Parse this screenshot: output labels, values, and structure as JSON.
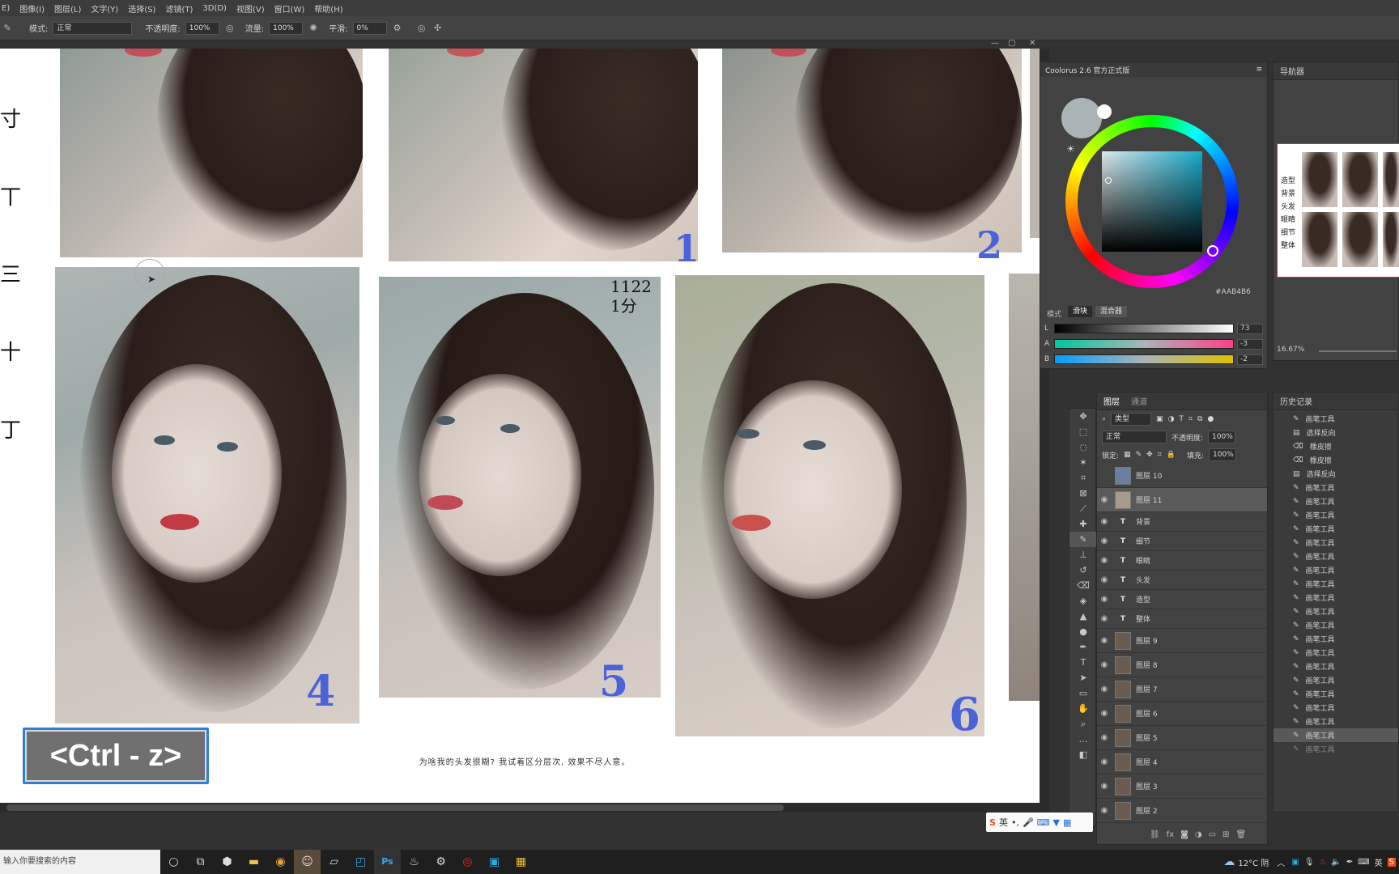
{
  "menubar": {
    "items": [
      "E)",
      "图像(I)",
      "图层(L)",
      "文字(Y)",
      "选择(S)",
      "滤镜(T)",
      "3D(D)",
      "视图(V)",
      "窗口(W)",
      "帮助(H)"
    ]
  },
  "options": {
    "mode_label": "模式:",
    "mode_value": "正常",
    "opacity_label": "不透明度:",
    "opacity_value": "100%",
    "flow_label": "流量:",
    "flow_value": "100%",
    "smooth_label": "平滑:",
    "smooth_value": "0%"
  },
  "canvas": {
    "numbers": [
      "1",
      "2",
      "4",
      "5",
      "6"
    ],
    "signature": "1122 1分",
    "caption": "为啥我的头发很糊? 我试着区分层次, 效果不尽人意。",
    "shortcut_label": "<Ctrl - z>",
    "left_strokes": [
      "寸",
      "丅",
      "三",
      "十",
      "丁"
    ]
  },
  "coolorus": {
    "title": "Coolorus 2.6 官方正式版",
    "hex": "#AAB4B6",
    "mode_label": "模式",
    "tab_slider": "滑块",
    "tab_mixer": "混合器",
    "sliders": [
      {
        "label": "L",
        "value": "73"
      },
      {
        "label": "A",
        "value": "-3"
      },
      {
        "label": "B",
        "value": "-2"
      }
    ]
  },
  "navigator": {
    "title": "导航器",
    "zoom": "16.67%",
    "thumb_labels": [
      "造型",
      "背景",
      "头发",
      "眼睛",
      "细节",
      "整体"
    ]
  },
  "layers": {
    "tabs": [
      "图层",
      "通道"
    ],
    "filter_label": "类型",
    "blend_mode": "正常",
    "opacity_label": "不透明度:",
    "opacity_value": "100%",
    "lock_label": "锁定:",
    "fill_label": "填充:",
    "fill_value": "100%",
    "items": [
      {
        "name": "图层 10",
        "kind": "image",
        "visible": false
      },
      {
        "name": "图层 11",
        "kind": "image",
        "visible": true
      },
      {
        "name": "背景",
        "kind": "text",
        "visible": true
      },
      {
        "name": "细节",
        "kind": "text",
        "visible": true
      },
      {
        "name": "眼睛",
        "kind": "text",
        "visible": true
      },
      {
        "name": "头发",
        "kind": "text",
        "visible": true
      },
      {
        "name": "造型",
        "kind": "text",
        "visible": true
      },
      {
        "name": "整体",
        "kind": "text",
        "visible": true
      },
      {
        "name": "图层 9",
        "kind": "image",
        "visible": true
      },
      {
        "name": "图层 8",
        "kind": "image",
        "visible": true
      },
      {
        "name": "图层 7",
        "kind": "image",
        "visible": true
      },
      {
        "name": "图层 6",
        "kind": "image",
        "visible": true
      },
      {
        "name": "图层 5",
        "kind": "image",
        "visible": true
      },
      {
        "name": "图层 4",
        "kind": "image",
        "visible": true
      },
      {
        "name": "图层 3",
        "kind": "image",
        "visible": true
      },
      {
        "name": "图层 2",
        "kind": "image",
        "visible": true
      }
    ],
    "footer_icons": [
      "link-icon",
      "fx-icon",
      "mask-icon",
      "adjustment-icon",
      "folder-icon",
      "new-layer-icon",
      "trash-icon"
    ]
  },
  "history": {
    "title": "历史记录",
    "items": [
      "画笔工具",
      "选择反向",
      "橡皮擦",
      "橡皮擦",
      "选择反向",
      "画笔工具",
      "画笔工具",
      "画笔工具",
      "画笔工具",
      "画笔工具",
      "画笔工具",
      "画笔工具",
      "画笔工具",
      "画笔工具",
      "画笔工具",
      "画笔工具",
      "画笔工具",
      "画笔工具",
      "画笔工具",
      "画笔工具",
      "画笔工具",
      "画笔工具",
      "画笔工具",
      "画笔工具",
      "画笔工具"
    ]
  },
  "ime": {
    "label": "英"
  },
  "taskbar": {
    "search_placeholder": "输入你要搜索的内容",
    "weather": "12°C 阴",
    "lang": "英"
  },
  "colors": {
    "accent": "#2f7fd8",
    "number_ink": "#4a63d9",
    "ui_bg": "#424242"
  }
}
